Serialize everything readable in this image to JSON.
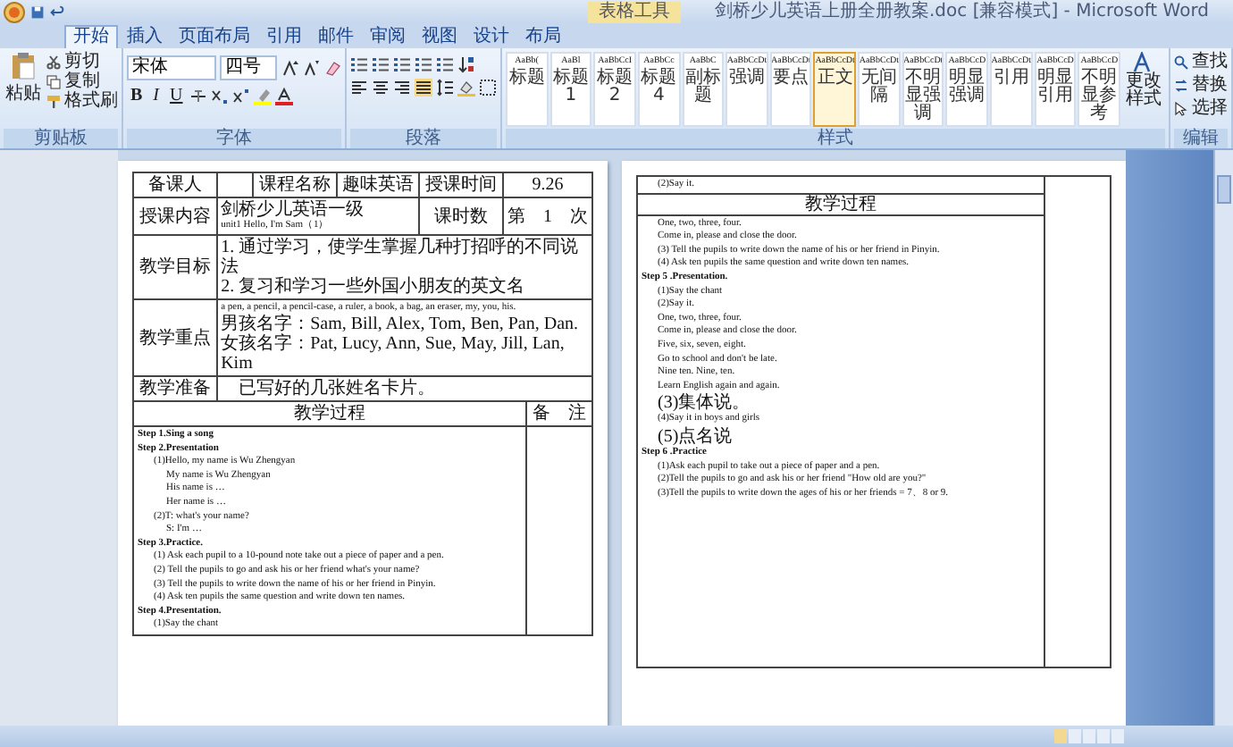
{
  "window": {
    "title": "剑桥少儿英语上册全册教案.doc [兼容模式] - Microsoft Word",
    "context_tab": "表格工具"
  },
  "ribbon_tabs": [
    {
      "label": "开始",
      "selected": true
    },
    {
      "label": "插入",
      "selected": false
    },
    {
      "label": "页面布局",
      "selected": false
    },
    {
      "label": "引用",
      "selected": false
    },
    {
      "label": "邮件",
      "selected": false
    },
    {
      "label": "审阅",
      "selected": false
    },
    {
      "label": "视图",
      "selected": false
    },
    {
      "label": "设计",
      "selected": false
    },
    {
      "label": "布局",
      "selected": false
    }
  ],
  "clipboard": {
    "paste": "粘贴",
    "cut": "剪切",
    "copy": "复制",
    "format_painter": "格式刷",
    "label": "剪贴板"
  },
  "font": {
    "name": "宋体",
    "size": "四号",
    "format_buttons": [
      "B",
      "I",
      "U"
    ],
    "label": "字体"
  },
  "paragraph": {
    "label": "段落"
  },
  "styles": {
    "label": "样式",
    "change": "更改样式",
    "items": [
      {
        "sample": "AaBb(",
        "name": "标题",
        "selected": false
      },
      {
        "sample": "AaBl",
        "name": "标题 1",
        "selected": false
      },
      {
        "sample": "AaBbCcI",
        "name": "标题 2",
        "selected": false
      },
      {
        "sample": "AaBbCc",
        "name": "标题 4",
        "selected": false
      },
      {
        "sample": "AaBbC",
        "name": "副标题",
        "selected": false
      },
      {
        "sample": "AaBbCcDt",
        "name": "强调",
        "selected": false
      },
      {
        "sample": "AaBbCcDt",
        "name": "要点",
        "selected": false
      },
      {
        "sample": "AaBbCcDt",
        "name": "正文",
        "selected": true
      },
      {
        "sample": "AaBbCcDt",
        "name": "无间隔",
        "selected": false
      },
      {
        "sample": "AaBbCcDt",
        "name": "不明显强调",
        "selected": false
      },
      {
        "sample": "AaBbCcD",
        "name": "明显强调",
        "selected": false
      },
      {
        "sample": "AaBbCcDt",
        "name": "引用",
        "selected": false
      },
      {
        "sample": "AaBbCcD",
        "name": "明显引用",
        "selected": false
      },
      {
        "sample": "AaBbCcD",
        "name": "不明显参考",
        "selected": false
      }
    ]
  },
  "editing": {
    "find": "查找",
    "replace": "替换",
    "select": "选择",
    "label": "编辑"
  },
  "info_table": {
    "preparer_label": "备课人",
    "course_label": "课程名称",
    "course": "趣味英语",
    "time_label": "授课时间",
    "time": "9.26",
    "content_label": "授课内容",
    "content": [
      "剑桥少儿英语一级",
      "unit1 Hello, I'm Sam（1）"
    ],
    "periods_label": "课时数",
    "periods": "第　1　次",
    "goals_label": "教学目标",
    "goals": [
      "1. 通过学习，使学生掌握几种打招呼的不同说法",
      "2. 复习和学习一些外国小朋友的英文名"
    ],
    "focus_label": "教学重点",
    "focus": [
      "a pen, a pencil, a pencil-case, a ruler, a book, a bag, an eraser, my, you, his.",
      "男孩名字：Sam, Bill, Alex, Tom, Ben, Pan, Dan.",
      "女孩名字：Pat, Lucy, Ann, Sue, May, Jill, Lan, Kim"
    ],
    "prep_label": "教学准备",
    "prep": "已写好的几张姓名卡片。"
  },
  "process_header": {
    "title": "教学过程",
    "notes": "备　注"
  },
  "left_lines": [
    {
      "kind": "step",
      "text": "Step 1.Sing a song"
    },
    {
      "kind": "step",
      "text": "Step 2.Presentation"
    },
    {
      "kind": "item",
      "text": "(1)Hello, my name is Wu Zhengyan"
    },
    {
      "kind": "sub",
      "text": "My name is Wu Zhengyan"
    },
    {
      "kind": "sub",
      "text": "His name is …"
    },
    {
      "kind": "sub",
      "text": "Her name is …"
    },
    {
      "kind": "item",
      "text": "(2)T: what's your name?"
    },
    {
      "kind": "sub",
      "text": "S: I'm …"
    },
    {
      "kind": "step",
      "text": "Step 3.Practice."
    },
    {
      "kind": "item",
      "text": "(1) Ask each pupil to a 10-pound note take out a piece of paper and a pen."
    },
    {
      "kind": "item",
      "text": "(2) Tell the pupils to go and ask his or her friend what's your name?"
    },
    {
      "kind": "item",
      "text": "(3) Tell the pupils to write down the name of his or her friend in Pinyin."
    },
    {
      "kind": "item",
      "text": "(4) Ask ten pupils the same question and write down ten names."
    },
    {
      "kind": "step",
      "text": "Step 4.Presentation."
    },
    {
      "kind": "item",
      "text": "(1)Say the chant"
    }
  ],
  "right_page": {
    "carry_line": "(2)Say it.",
    "header": "教学过程",
    "lines": [
      {
        "kind": "item",
        "text": "One, two, three, four."
      },
      {
        "kind": "item",
        "text": "Come in, please and close the door."
      },
      {
        "kind": "item",
        "text": "(3) Tell the pupils to write down the name of his or her friend in Pinyin."
      },
      {
        "kind": "item",
        "text": "(4) Ask ten pupils the same question and write down ten names."
      },
      {
        "kind": "step",
        "text": "Step 5 .Presentation."
      },
      {
        "kind": "item",
        "text": "(1)Say the chant"
      },
      {
        "kind": "item",
        "text": "(2)Say it."
      },
      {
        "kind": "item",
        "text": "One, two, three, four."
      },
      {
        "kind": "item",
        "text": "Come in, please and close the door."
      },
      {
        "kind": "item",
        "text": "Five, six, seven, eight."
      },
      {
        "kind": "item",
        "text": "Go to school and don't be late."
      },
      {
        "kind": "item",
        "text": "Nine ten. Nine, ten."
      },
      {
        "kind": "item",
        "text": "Learn English again and again."
      },
      {
        "kind": "item",
        "text": "(3)集体说。"
      },
      {
        "kind": "item",
        "text": "(4)Say it in boys and girls"
      },
      {
        "kind": "item",
        "text": "(5)点名说"
      },
      {
        "kind": "step",
        "text": "Step 6 .Practice"
      },
      {
        "kind": "item",
        "text": "(1)Ask each pupil to take out a piece of paper and a pen."
      },
      {
        "kind": "item",
        "text": "(2)Tell the pupils to go and ask his or her friend \"How old are you?\""
      },
      {
        "kind": "item",
        "text": "(3)Tell the pupils to write down the ages of his or her friends = 7、8 or 9."
      }
    ]
  }
}
